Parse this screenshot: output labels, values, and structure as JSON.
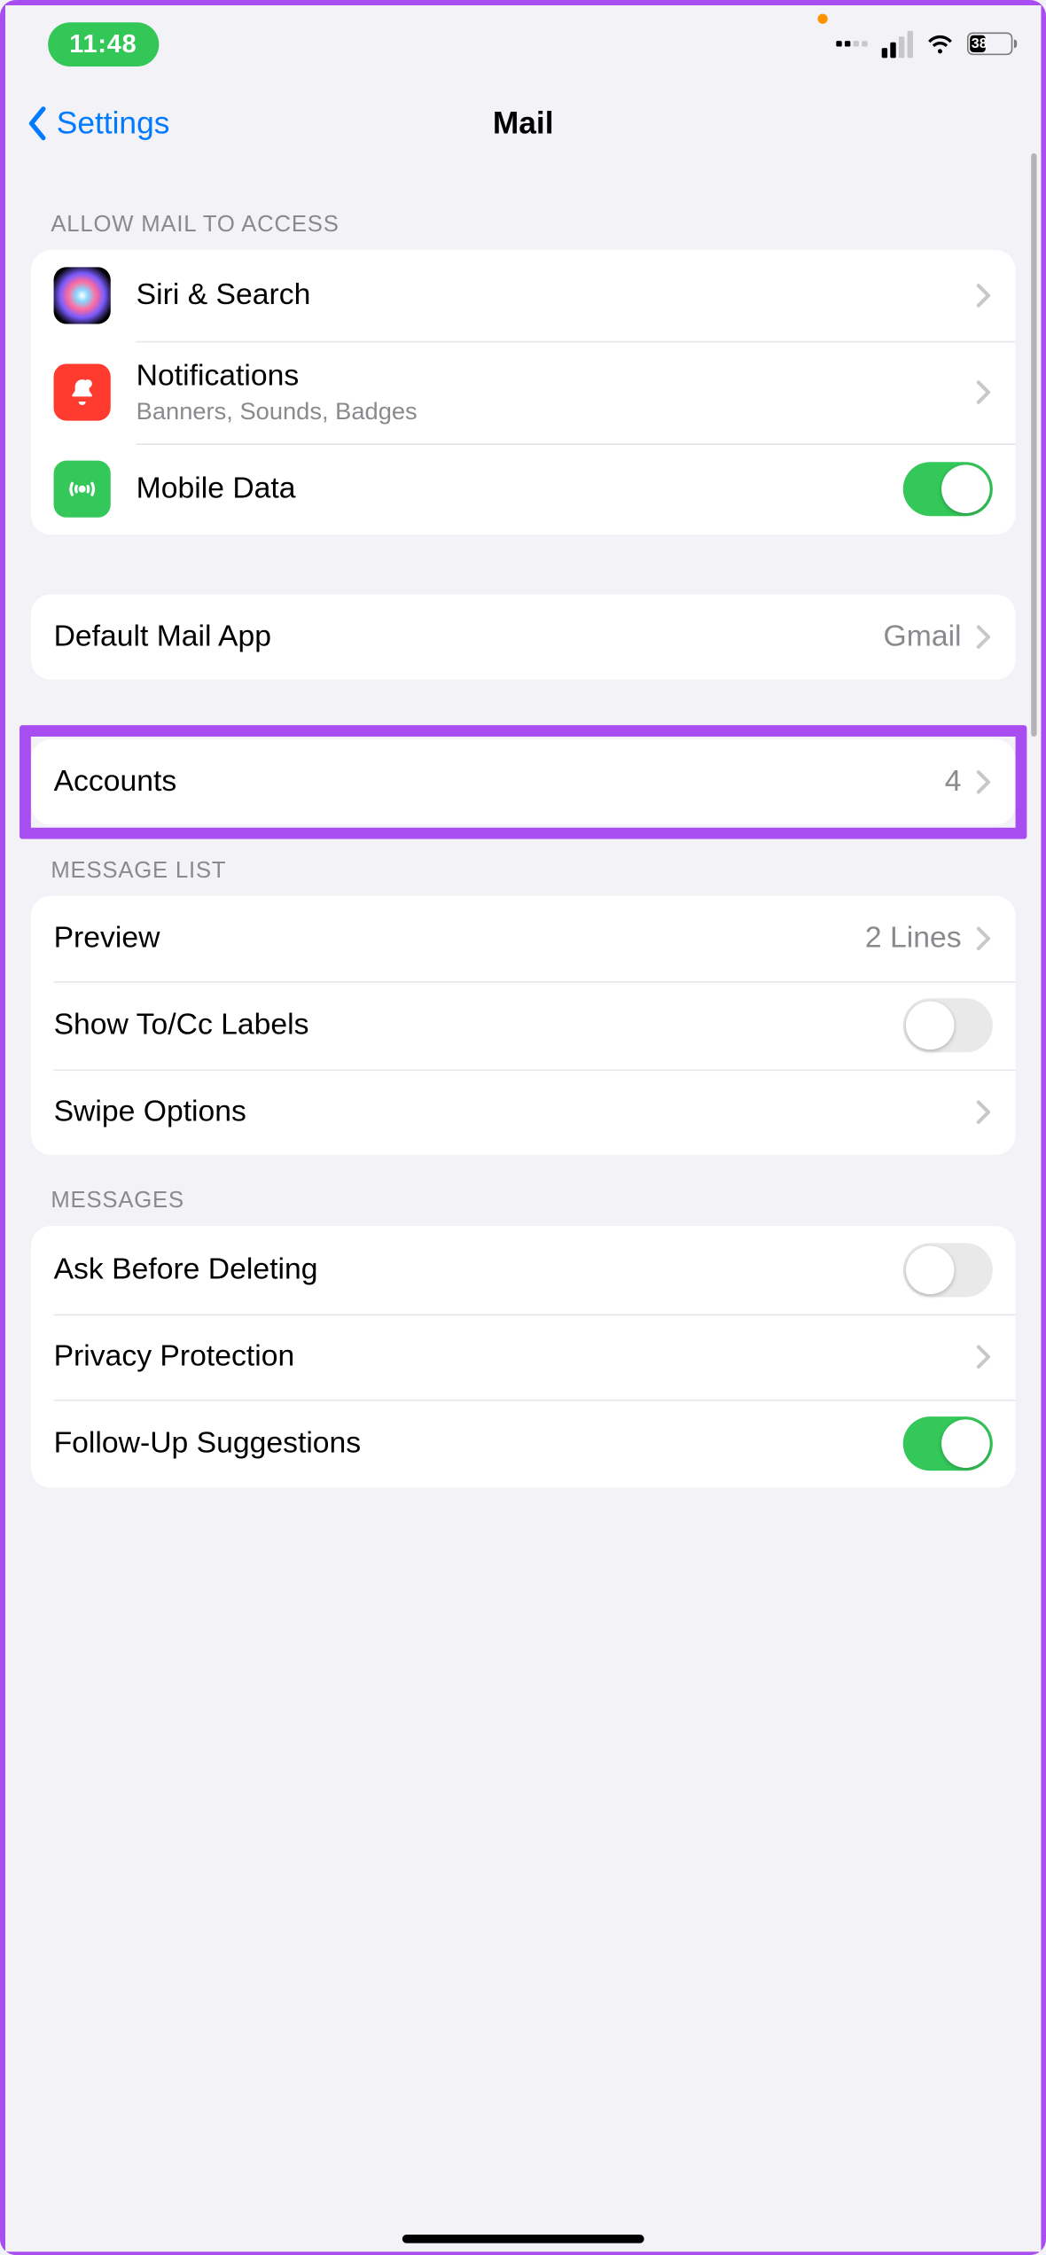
{
  "statusbar": {
    "time": "11:48",
    "battery_pct": "38"
  },
  "nav": {
    "back_label": "Settings",
    "title": "Mail"
  },
  "access": {
    "header": "ALLOW MAIL TO ACCESS",
    "siri_label": "Siri & Search",
    "notifications_label": "Notifications",
    "notifications_sub": "Banners, Sounds, Badges",
    "mobile_data_label": "Mobile Data",
    "mobile_data_on": true
  },
  "default_app": {
    "label": "Default Mail App",
    "value": "Gmail"
  },
  "accounts": {
    "label": "Accounts",
    "count": "4"
  },
  "message_list": {
    "header": "MESSAGE LIST",
    "preview_label": "Preview",
    "preview_value": "2 Lines",
    "show_tocc_label": "Show To/Cc Labels",
    "show_tocc_on": false,
    "swipe_label": "Swipe Options"
  },
  "messages": {
    "header": "MESSAGES",
    "ask_delete_label": "Ask Before Deleting",
    "ask_delete_on": false,
    "privacy_label": "Privacy Protection",
    "followup_label": "Follow-Up Suggestions",
    "followup_on": true
  }
}
